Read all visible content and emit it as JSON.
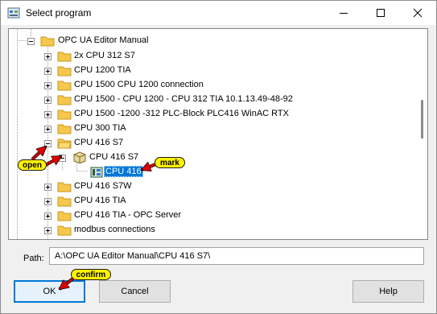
{
  "window": {
    "title": "Select program",
    "minimize_icon": "minimize-icon",
    "maximize_icon": "maximize-icon",
    "close_icon": "close-icon"
  },
  "tree": {
    "root": {
      "label": "OPC UA Editor Manual",
      "state": "expanded"
    },
    "items": [
      {
        "label": "2x CPU 312 S7",
        "state": "collapsed",
        "icon": "folder-icon"
      },
      {
        "label": "CPU 1200 TIA",
        "state": "collapsed",
        "icon": "folder-icon"
      },
      {
        "label": "CPU 1500  CPU 1200 connection",
        "state": "collapsed",
        "icon": "folder-icon"
      },
      {
        "label": "CPU 1500 - CPU 1200 - CPU 312 TIA 10.1.13.49-48-92",
        "state": "collapsed",
        "icon": "folder-icon"
      },
      {
        "label": "CPU 1500 -1200 -312 PLC-Block PLC416 WinAC RTX",
        "state": "collapsed",
        "icon": "folder-icon"
      },
      {
        "label": "CPU 300 TIA",
        "state": "collapsed",
        "icon": "folder-icon"
      },
      {
        "label": "CPU 416 S7",
        "state": "expanded",
        "icon": "folder-icon"
      },
      {
        "label": "CPU 416 S7",
        "state": "expanded",
        "icon": "station-icon"
      },
      {
        "label": "CPU 416",
        "state": "selected",
        "icon": "cpu-icon"
      },
      {
        "label": "CPU 416 S7W",
        "state": "collapsed",
        "icon": "folder-icon"
      },
      {
        "label": "CPU 416 TIA",
        "state": "collapsed",
        "icon": "folder-icon"
      },
      {
        "label": "CPU 416 TIA - OPC Server",
        "state": "collapsed",
        "icon": "folder-icon"
      },
      {
        "label": "modbus connections",
        "state": "collapsed",
        "icon": "folder-icon"
      }
    ]
  },
  "path": {
    "label": "Path:",
    "value": "A:\\OPC UA Editor Manual\\CPU 416 S7\\"
  },
  "buttons": {
    "ok": "OK",
    "cancel": "Cancel",
    "help": "Help"
  },
  "annotations": {
    "open": "open",
    "mark": "mark",
    "confirm": "confirm",
    "color": "#fff200",
    "arrow_color": "#e00000"
  },
  "colors": {
    "selection": "#0078d7",
    "folder": "#f6c74d",
    "default_button_border": "#0078d7"
  }
}
